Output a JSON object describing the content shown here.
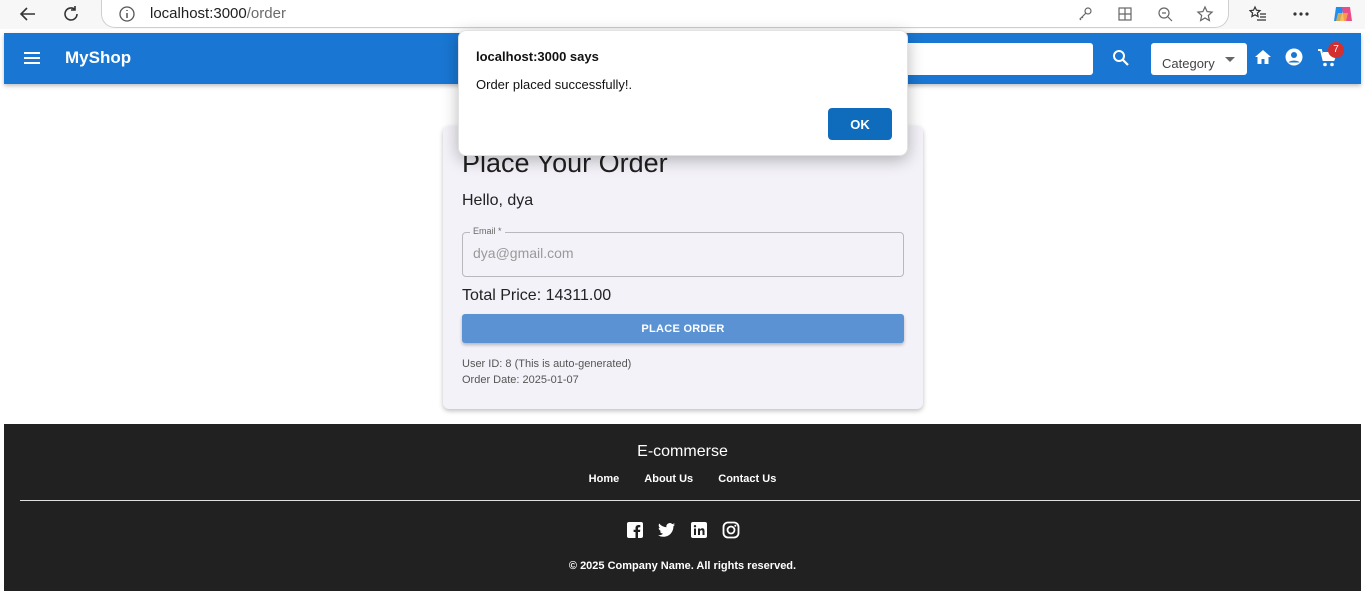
{
  "browser": {
    "url_host": "localhost:3000",
    "url_path": "/order"
  },
  "appbar": {
    "brand": "MyShop",
    "category_label": "Category",
    "cart_count": "7"
  },
  "order": {
    "heading": "Place Your Order",
    "greeting": "Hello, dya",
    "email_label": "Email *",
    "email_value": "dya@gmail.com",
    "total": "Total Price: 14311.00",
    "button": "PLACE ORDER",
    "user_id": "User ID: 8 (This is auto-generated)",
    "order_date": "Order Date: 2025-01-07"
  },
  "footer": {
    "title": "E-commerse",
    "links": [
      "Home",
      "About Us",
      "Contact Us"
    ],
    "social_icons": [
      "facebook-icon",
      "twitter-icon",
      "linkedin-icon",
      "instagram-icon"
    ],
    "copyright": "© 2025 Company Name. All rights reserved."
  },
  "dialog": {
    "title": "localhost:3000 says",
    "message": "Order placed successfully!.",
    "ok": "OK"
  },
  "colors": {
    "appbar": "#1976d2",
    "footer": "#212121",
    "button": "#5a92d3",
    "dialog_ok": "#0f6cbd",
    "badge": "#d32f2f"
  }
}
